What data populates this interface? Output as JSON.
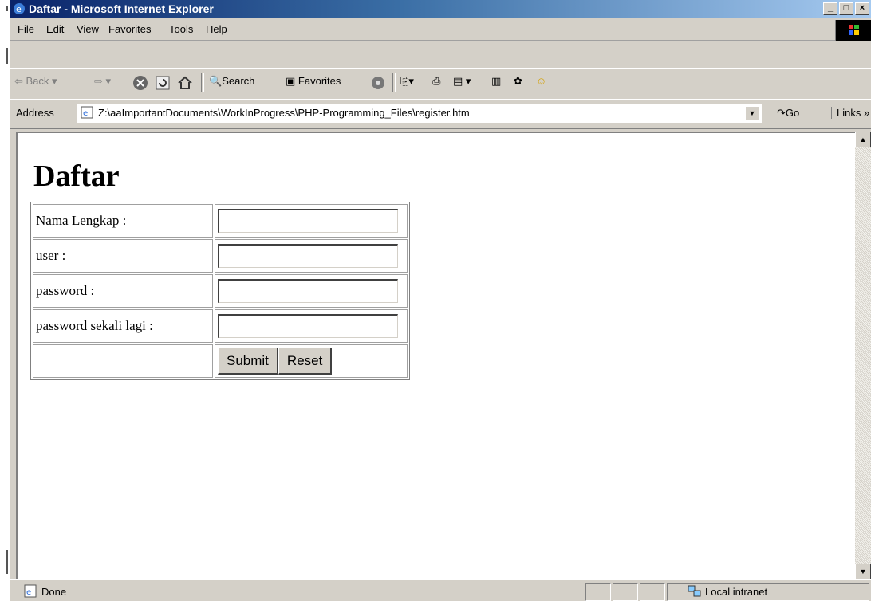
{
  "window": {
    "title": "Daftar - Microsoft Internet Explorer"
  },
  "menu": [
    "File",
    "Edit",
    "View",
    "Favorites",
    "Tools",
    "Help"
  ],
  "toolbar": {
    "back": "Back",
    "search": "Search",
    "favorites": "Favorites"
  },
  "address": {
    "label": "Address",
    "url": "Z:\\aaImportantDocuments\\WorkInProgress\\PHP-Programming_Files\\register.htm",
    "go": "Go",
    "links": "Links"
  },
  "page": {
    "heading": "Daftar",
    "fields": [
      {
        "label": "Nama Lengkap :",
        "value": ""
      },
      {
        "label": "user :",
        "value": ""
      },
      {
        "label": "password :",
        "value": ""
      },
      {
        "label": "password sekali lagi :",
        "value": ""
      }
    ],
    "submit": "Submit",
    "reset": "Reset"
  },
  "status": {
    "text": "Done",
    "zone": "Local intranet"
  }
}
